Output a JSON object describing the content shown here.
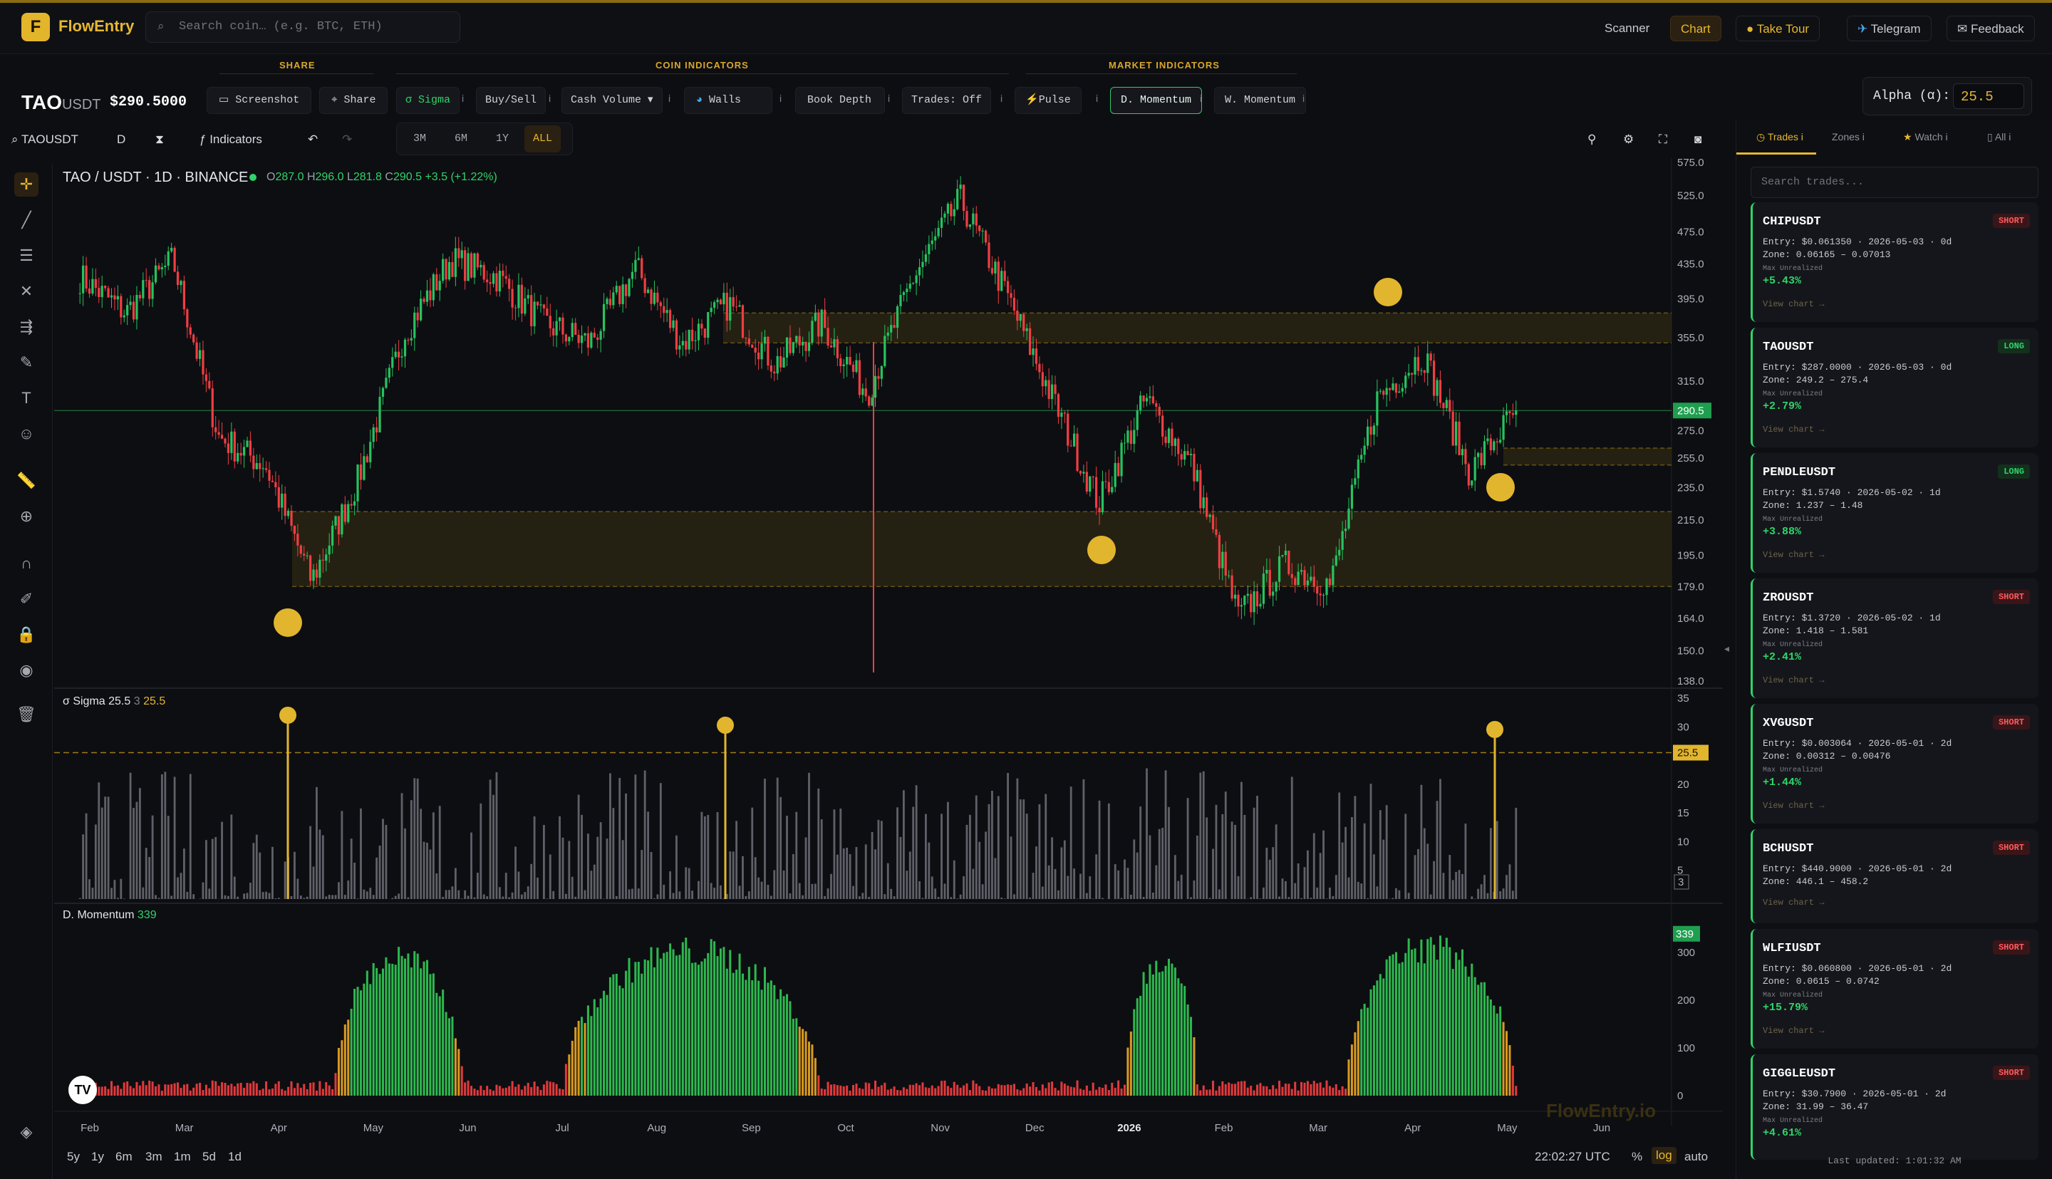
{
  "app": {
    "logo_letter": "F",
    "name": "FlowEntry",
    "search_placeholder": "Search coin… (e.g. BTC, ETH)"
  },
  "nav": {
    "scanner": "Scanner",
    "chart": "Chart",
    "take_tour": "Take Tour",
    "telegram": "Telegram",
    "feedback": "Feedback"
  },
  "sections": {
    "share": "SHARE",
    "coin": "COIN INDICATORS",
    "market": "MARKET INDICATORS"
  },
  "symbol": {
    "base": "TAO",
    "quote": "USDT",
    "price": "$290.5000"
  },
  "toolbar": {
    "screenshot": "Screenshot",
    "share": "Share",
    "sigma": "σ Sigma",
    "buysell": "Buy/Sell",
    "cashvol": "Cash Volume",
    "walls": "Walls",
    "bookdepth": "Book Depth",
    "trades": "Trades: Off",
    "pulse": "Pulse",
    "dmom": "D. Momentum",
    "wmom": "W. Momentum",
    "info": "i"
  },
  "alpha": {
    "label": "Alpha (α):",
    "value": "25.5"
  },
  "chart_toolbar": {
    "symbol": "TAOUSDT",
    "interval": "D",
    "indicators": "Indicators",
    "ranges": [
      "3M",
      "6M",
      "1Y",
      "ALL"
    ],
    "selected_range": "ALL"
  },
  "legend": {
    "title": "TAO / USDT · 1D · BINANCE",
    "o": "287.0",
    "h": "296.0",
    "l": "281.8",
    "c": "290.5",
    "chg": "+3.5 (+1.22%)"
  },
  "price_axis": [
    "575.0",
    "525.0",
    "475.0",
    "435.0",
    "395.0",
    "355.0",
    "315.0",
    "275.0",
    "255.0",
    "235.0",
    "215.0",
    "195.0",
    "179.0",
    "164.0",
    "150.0",
    "138.0"
  ],
  "last_price_tag": "290.5",
  "sigma": {
    "label": "σ Sigma 25.5",
    "count": "3",
    "value": "25.5",
    "axis": [
      "35",
      "30",
      "25",
      "20",
      "15",
      "10",
      "5"
    ],
    "threshold_tag": "25.5",
    "last_tag": "3"
  },
  "momentum": {
    "label": "D. Momentum",
    "value": "339",
    "axis": [
      "300",
      "200",
      "100",
      "0"
    ],
    "tag": "339"
  },
  "time_axis": [
    "Feb",
    "Mar",
    "Apr",
    "May",
    "Jun",
    "Jul",
    "Aug",
    "Sep",
    "Oct",
    "Nov",
    "Dec",
    "2026",
    "Feb",
    "Mar",
    "Apr",
    "May",
    "Jun"
  ],
  "watermark": "FlowEntry.io",
  "bottom": {
    "ranges": [
      "5y",
      "1y",
      "6m",
      "3m",
      "1m",
      "5d",
      "1d"
    ],
    "clock": "22:02:27 UTC",
    "pct": "%",
    "log": "log",
    "auto": "auto"
  },
  "colors": {
    "accent": "#e6b72f",
    "up": "#2fd46a",
    "down": "#ff4d4f",
    "zone": "#3a3212"
  },
  "chart_data": {
    "type": "candlestick",
    "title": "TAO / USDT · 1D · BINANCE",
    "scale": "log",
    "ylim": [
      138,
      575
    ],
    "x_ticks": [
      "Feb",
      "Mar",
      "Apr",
      "May",
      "Jun",
      "Jul",
      "Aug",
      "Sep",
      "Oct",
      "Nov",
      "Dec",
      "2026",
      "Feb",
      "Mar",
      "Apr",
      "May",
      "Jun"
    ],
    "approx_close_path": [
      {
        "x": "Feb",
        "y": 420
      },
      {
        "x": "Feb",
        "y": 380
      },
      {
        "x": "Mar",
        "y": 440
      },
      {
        "x": "Mar",
        "y": 270
      },
      {
        "x": "Apr",
        "y": 250
      },
      {
        "x": "Apr",
        "y": 182
      },
      {
        "x": "Apr",
        "y": 240
      },
      {
        "x": "May",
        "y": 360
      },
      {
        "x": "May",
        "y": 440
      },
      {
        "x": "Jun",
        "y": 420
      },
      {
        "x": "Jun",
        "y": 370
      },
      {
        "x": "Jul",
        "y": 350
      },
      {
        "x": "Jul",
        "y": 430
      },
      {
        "x": "Aug",
        "y": 350
      },
      {
        "x": "Aug",
        "y": 390
      },
      {
        "x": "Sep",
        "y": 330
      },
      {
        "x": "Sep",
        "y": 370
      },
      {
        "x": "Oct",
        "y": 305
      },
      {
        "x": "Oct",
        "y": 420
      },
      {
        "x": "Nov",
        "y": 520
      },
      {
        "x": "Nov",
        "y": 400
      },
      {
        "x": "Dec",
        "y": 300
      },
      {
        "x": "Dec",
        "y": 225
      },
      {
        "x": "Dec",
        "y": 300
      },
      {
        "x": "2026",
        "y": 250
      },
      {
        "x": "Feb",
        "y": 165
      },
      {
        "x": "Feb",
        "y": 190
      },
      {
        "x": "Mar",
        "y": 180
      },
      {
        "x": "Mar",
        "y": 300
      },
      {
        "x": "Apr",
        "y": 340
      },
      {
        "x": "Apr",
        "y": 245
      },
      {
        "x": "May",
        "y": 290.5
      }
    ],
    "zones": [
      [
        350,
        380
      ],
      [
        179,
        220
      ],
      [
        250,
        262
      ]
    ],
    "signal_markers": [
      "Apr",
      "Dec",
      "Mar",
      "Apr"
    ]
  },
  "right_panel": {
    "tabs": [
      "Trades",
      "Zones",
      "Watch",
      "All"
    ],
    "search_placeholder": "Search trades...",
    "cards": [
      {
        "sym": "CHIPUSDT",
        "side": "SHORT",
        "entry": "Entry: $0.061350 · 2026-05-03 · 0d",
        "zone": "Zone: 0.06165 – 0.07013",
        "max_label": "Max Unrealized",
        "pct": "+5.43%",
        "link": "View chart →"
      },
      {
        "sym": "TAOUSDT",
        "side": "LONG",
        "entry": "Entry: $287.0000 · 2026-05-03 · 0d",
        "zone": "Zone: 249.2 – 275.4",
        "max_label": "Max Unrealized",
        "pct": "+2.79%",
        "link": "View chart →"
      },
      {
        "sym": "PENDLEUSDT",
        "side": "LONG",
        "entry": "Entry: $1.5740 · 2026-05-02 · 1d",
        "zone": "Zone: 1.237 – 1.48",
        "max_label": "Max Unrealized",
        "pct": "+3.88%",
        "link": "View chart →"
      },
      {
        "sym": "ZROUSDT",
        "side": "SHORT",
        "entry": "Entry: $1.3720 · 2026-05-02 · 1d",
        "zone": "Zone: 1.418 – 1.581",
        "max_label": "Max Unrealized",
        "pct": "+2.41%",
        "link": "View chart →"
      },
      {
        "sym": "XVGUSDT",
        "side": "SHORT",
        "entry": "Entry: $0.003064 · 2026-05-01 · 2d",
        "zone": "Zone: 0.00312 – 0.00476",
        "max_label": "Max Unrealized",
        "pct": "+1.44%",
        "link": "View chart →"
      },
      {
        "sym": "BCHUSDT",
        "side": "SHORT",
        "entry": "Entry: $440.9000 · 2026-05-01 · 2d",
        "zone": "Zone: 446.1 – 458.2",
        "max_label": "",
        "pct": "",
        "link": "View chart →"
      },
      {
        "sym": "WLFIUSDT",
        "side": "SHORT",
        "entry": "Entry: $0.060800 · 2026-05-01 · 2d",
        "zone": "Zone: 0.0615 – 0.0742",
        "max_label": "Max Unrealized",
        "pct": "+15.79%",
        "link": "View chart →"
      },
      {
        "sym": "GIGGLEUSDT",
        "side": "SHORT",
        "entry": "Entry: $30.7900 · 2026-05-01 · 2d",
        "zone": "Zone: 31.99 – 36.47",
        "max_label": "Max Unrealized",
        "pct": "+4.61%",
        "link": ""
      }
    ],
    "updated": "Last updated: 1:01:32 AM"
  }
}
